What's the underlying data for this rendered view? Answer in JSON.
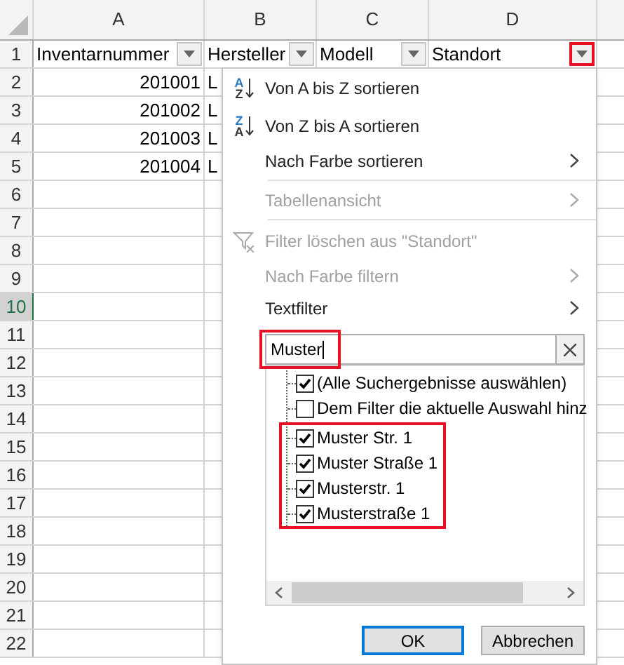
{
  "columns": [
    "A",
    "B",
    "C",
    "D"
  ],
  "rows": [
    {
      "number": "1",
      "selected": false,
      "cells": [
        {
          "kind": "text",
          "text": "Inventarnummer",
          "filter": true,
          "highlighted": false
        },
        {
          "kind": "text",
          "text": "Hersteller",
          "filter": true,
          "highlighted": false
        },
        {
          "kind": "text",
          "text": "Modell",
          "filter": true,
          "highlighted": false
        },
        {
          "kind": "text",
          "text": "Standort",
          "filter": true,
          "highlighted": true
        }
      ]
    },
    {
      "number": "2",
      "selected": false,
      "cells": [
        {
          "kind": "number",
          "text": "201001"
        },
        {
          "kind": "text",
          "text": "L"
        }
      ]
    },
    {
      "number": "3",
      "selected": false,
      "cells": [
        {
          "kind": "number",
          "text": "201002"
        },
        {
          "kind": "text",
          "text": "L"
        }
      ]
    },
    {
      "number": "4",
      "selected": false,
      "cells": [
        {
          "kind": "number",
          "text": "201003"
        },
        {
          "kind": "text",
          "text": "L"
        }
      ]
    },
    {
      "number": "5",
      "selected": false,
      "cells": [
        {
          "kind": "number",
          "text": "201004"
        },
        {
          "kind": "text",
          "text": "L"
        }
      ]
    },
    {
      "number": "6",
      "selected": false,
      "cells": []
    },
    {
      "number": "7",
      "selected": false,
      "cells": []
    },
    {
      "number": "8",
      "selected": false,
      "cells": []
    },
    {
      "number": "9",
      "selected": false,
      "cells": []
    },
    {
      "number": "10",
      "selected": true,
      "cells": []
    },
    {
      "number": "11",
      "selected": false,
      "cells": []
    },
    {
      "number": "12",
      "selected": false,
      "cells": []
    },
    {
      "number": "13",
      "selected": false,
      "cells": []
    },
    {
      "number": "14",
      "selected": false,
      "cells": []
    },
    {
      "number": "15",
      "selected": false,
      "cells": []
    },
    {
      "number": "16",
      "selected": false,
      "cells": []
    },
    {
      "number": "17",
      "selected": false,
      "cells": []
    },
    {
      "number": "18",
      "selected": false,
      "cells": []
    },
    {
      "number": "19",
      "selected": false,
      "cells": []
    },
    {
      "number": "20",
      "selected": false,
      "cells": []
    },
    {
      "number": "21",
      "selected": false,
      "cells": []
    },
    {
      "number": "22",
      "selected": false,
      "cells": []
    }
  ],
  "filter_menu": {
    "items": [
      {
        "kind": "sort",
        "label": "Von A bis Z sortieren",
        "icon_top": "A",
        "icon_bottom": "Z",
        "disabled": false
      },
      {
        "kind": "sort",
        "label": "Von Z bis A sortieren",
        "icon_top": "Z",
        "icon_bottom": "A",
        "disabled": false
      },
      {
        "kind": "submenu",
        "label": "Nach Farbe sortieren",
        "disabled": false
      },
      {
        "kind": "separator"
      },
      {
        "kind": "submenu",
        "label": "Tabellenansicht",
        "disabled": true
      },
      {
        "kind": "separator"
      },
      {
        "kind": "clear",
        "label": "Filter löschen aus \"Standort\"",
        "disabled": true
      },
      {
        "kind": "submenu",
        "label": "Nach Farbe filtern",
        "disabled": true
      },
      {
        "kind": "submenu",
        "label": "Textfilter",
        "disabled": false
      }
    ],
    "search": {
      "value": "Muster",
      "highlighted": true
    },
    "values": [
      {
        "label": "(Alle Suchergebnisse auswählen)",
        "checked": true,
        "highlighted": false
      },
      {
        "label": "Dem Filter die aktuelle Auswahl hinz",
        "checked": false,
        "highlighted": false
      },
      {
        "label": "Muster Str. 1",
        "checked": true,
        "highlighted": true
      },
      {
        "label": "Muster Straße 1",
        "checked": true,
        "highlighted": true
      },
      {
        "label": "Musterstr. 1",
        "checked": true,
        "highlighted": true
      },
      {
        "label": "Musterstraße 1",
        "checked": true,
        "highlighted": true
      }
    ],
    "buttons": [
      {
        "label": "OK",
        "default": true
      },
      {
        "label": "Abbrechen",
        "default": false
      }
    ]
  }
}
